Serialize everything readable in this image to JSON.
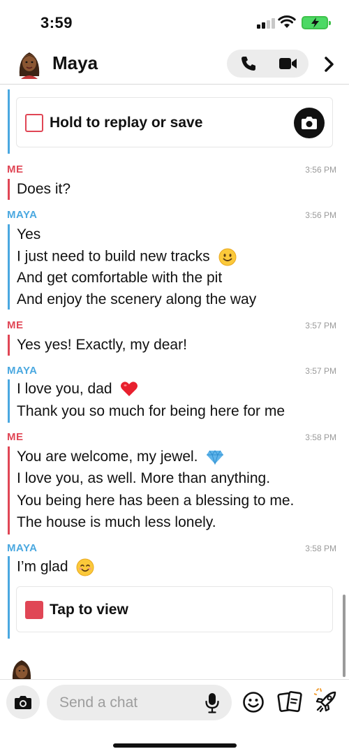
{
  "status_bar": {
    "time": "3:59"
  },
  "header": {
    "contact_name": "Maya",
    "icons": [
      "phone-icon",
      "video-icon",
      "chevron-right-icon"
    ]
  },
  "snaps": {
    "replay_label": "Hold to replay or save",
    "view_label": "Tap to view"
  },
  "messages": [
    {
      "sender": "ME",
      "time": "3:56 PM",
      "lines": [
        "Does it?"
      ]
    },
    {
      "sender": "MAYA",
      "time": "3:56 PM",
      "lines": [
        "Yes",
        "I just need to build new tracks",
        "And get comfortable with the pit",
        "And enjoy the scenery along the way"
      ]
    },
    {
      "sender": "ME",
      "time": "3:57 PM",
      "lines": [
        "Yes yes! Exactly, my dear!"
      ]
    },
    {
      "sender": "MAYA",
      "time": "3:57 PM",
      "lines": [
        "I love you, dad",
        "Thank you so much for being here for me"
      ]
    },
    {
      "sender": "ME",
      "time": "3:58 PM",
      "lines": [
        "You are welcome, my jewel.",
        "I love you, as well. More than anything.",
        "You being here has been a blessing to me.",
        "The house is much less lonely."
      ]
    },
    {
      "sender": "MAYA",
      "time": "3:58 PM",
      "lines": [
        "I’m glad"
      ]
    }
  ],
  "composer": {
    "placeholder": "Send a chat"
  },
  "colors": {
    "me": "#e04655",
    "maya": "#4aa8e0",
    "battery": "#4cd964"
  }
}
